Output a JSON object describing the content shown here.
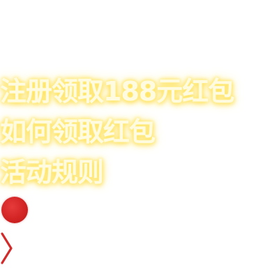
{
  "promo": {
    "lines": [
      "注册领取188元红包",
      "如何领取红包",
      "活动规则"
    ]
  },
  "icons": {
    "dot": "red-dot-icon",
    "arrow": "chevron-right-icon"
  },
  "colors": {
    "text_fill": "#fffbe0",
    "text_glow": "#ffe766",
    "dot_red": "#d32424",
    "chevron_red": "#d22b2b"
  }
}
